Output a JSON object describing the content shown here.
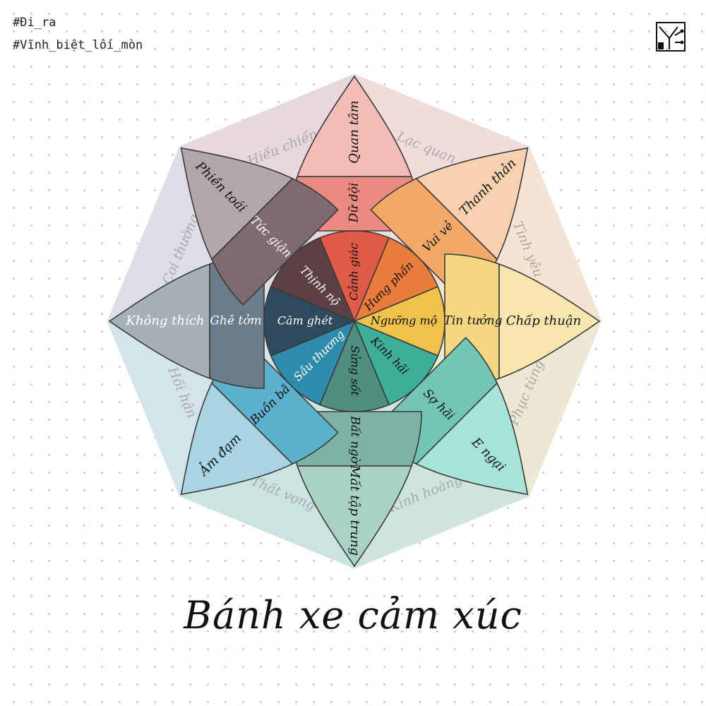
{
  "hashtags": [
    "#Đi_ra",
    "#Vĩnh_biệt_lối_mòn"
  ],
  "title": "Bánh xe cảm xúc",
  "icons": {
    "logo": "circuit-tree-logo"
  },
  "petals": [
    {
      "angle": 0,
      "inner": "Cảnh giác",
      "mid": "Dữ dội",
      "outer": "Quan tâm",
      "colors": [
        "#e05a48",
        "#ea8a80",
        "#f3bcb6"
      ]
    },
    {
      "angle": 45,
      "inner": "Hưng phấn",
      "mid": "Vui vẻ",
      "outer": "Thanh thản",
      "colors": [
        "#ea7d3c",
        "#f2a968",
        "#f8d2b0"
      ]
    },
    {
      "angle": 90,
      "inner": "Ngưỡng mộ",
      "mid": "Tin tưởng",
      "outer": "Chấp thuận",
      "colors": [
        "#efc24c",
        "#f5d782",
        "#f8e6ae"
      ]
    },
    {
      "angle": 135,
      "inner": "Kinh hãi",
      "mid": "Sợ hãi",
      "outer": "E ngại",
      "colors": [
        "#3fae96",
        "#73c6b5",
        "#a8e3d8"
      ]
    },
    {
      "angle": 180,
      "inner": "Sửng sốt",
      "mid": "Bất ngờ",
      "outer": "Mất tập trung",
      "colors": [
        "#4f8f80",
        "#7db2a4",
        "#a9d2c6"
      ]
    },
    {
      "angle": 225,
      "inner": "Sầu thương",
      "mid": "Buồn bã",
      "outer": "Ảm đạm",
      "colors": [
        "#2f8bab",
        "#5eb1cd",
        "#a8d4e3"
      ]
    },
    {
      "angle": 270,
      "inner": "Căm ghét",
      "mid": "Ghê tởm",
      "outer": "Không thích",
      "colors": [
        "#2e4a5c",
        "#6b7d8b",
        "#a6b0b9"
      ]
    },
    {
      "angle": 315,
      "inner": "Thịnh nộ",
      "mid": "Tức giận",
      "outer": "Phiền toái",
      "colors": [
        "#5c4046",
        "#7e6a70",
        "#b0a6ab"
      ]
    }
  ],
  "between": [
    {
      "angle": 22.5,
      "label": "Lạc quan",
      "tint": "#f1dcdc"
    },
    {
      "angle": 67.5,
      "label": "Tình yêu",
      "tint": "#f5e4d3"
    },
    {
      "angle": 112.5,
      "label": "Phục tùng",
      "tint": "#ede8d3"
    },
    {
      "angle": 157.5,
      "label": "Kinh hoàng",
      "tint": "#cfe3df"
    },
    {
      "angle": 202.5,
      "label": "Thất vọng",
      "tint": "#cbe4df"
    },
    {
      "angle": 247.5,
      "label": "Hối hận",
      "tint": "#d3e5ea"
    },
    {
      "angle": 292.5,
      "label": "Coi thường",
      "tint": "#dcdde5"
    },
    {
      "angle": 337.5,
      "label": "Hiếu chiến",
      "tint": "#e6d8dd"
    }
  ]
}
